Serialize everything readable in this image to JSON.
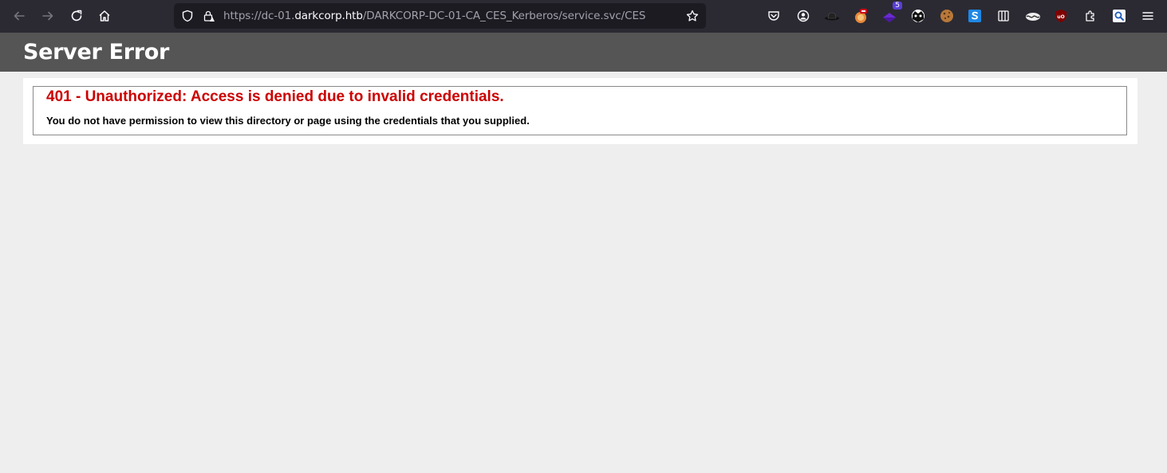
{
  "browser": {
    "url_prefix": "https://dc-01.",
    "url_host": "darkcorp.htb",
    "url_path": "/DARKCORP-DC-01-CA_CES_Kerberos/service.svc/CES",
    "extension_badge": "5"
  },
  "page": {
    "header_title": "Server Error",
    "error_title": "401 - Unauthorized: Access is denied due to invalid credentials.",
    "error_message": "You do not have permission to view this directory or page using the credentials that you supplied."
  },
  "colors": {
    "toolbar_bg": "#2b2a33",
    "urlbar_bg": "#1c1b22",
    "header_bg": "#555555",
    "error_red": "#cc0000",
    "page_bg": "#eeeeee"
  }
}
